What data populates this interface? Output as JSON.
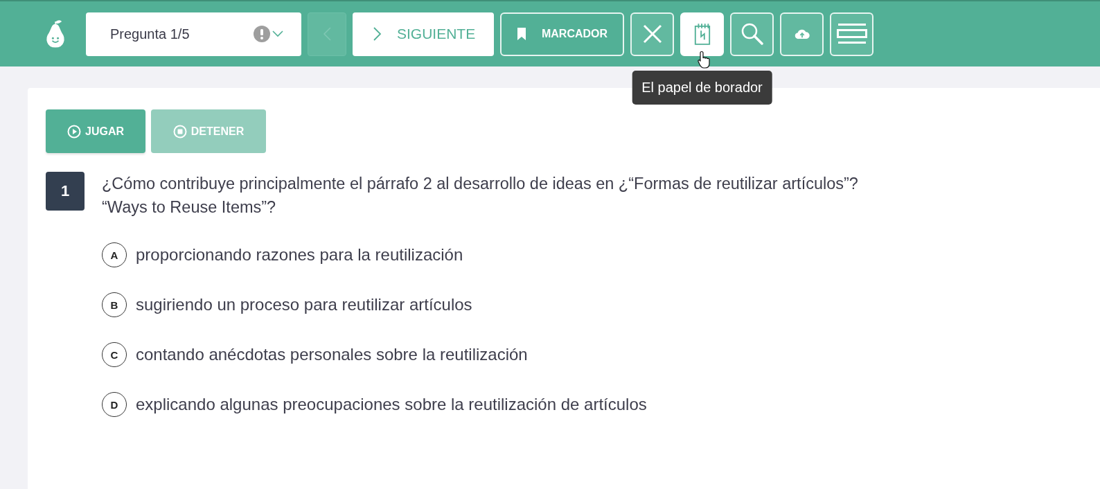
{
  "toolbar": {
    "question_selector": {
      "label": "Pregunta 1/5",
      "warning": true
    },
    "previous": {
      "disabled": true
    },
    "next": {
      "label": "SIGUIENTE",
      "disabled": false
    },
    "bookmark": {
      "label": "MARCADOR",
      "on": false
    },
    "tools": [
      {
        "kind": "close",
        "active": false
      },
      {
        "kind": "scratch",
        "active": true
      },
      {
        "kind": "search",
        "active": false
      },
      {
        "kind": "upload",
        "active": false
      },
      {
        "kind": "menu",
        "active": false
      }
    ],
    "tooltip": "El papel de borador"
  },
  "audio": [
    {
      "kind": "play",
      "label": "JUGAR",
      "disabled": false
    },
    {
      "kind": "stop",
      "label": "DETENER",
      "disabled": true
    }
  ],
  "question": {
    "number": "1",
    "lines": [
      "¿Cómo contribuye principalmente el párrafo 2 al desarrollo de ideas en ¿“Formas de reutilizar artículos”?",
      "“Ways to Reuse Items”?"
    ],
    "options": [
      {
        "letter": "A",
        "text": "proporcionando razones para la reutilización",
        "selected": false
      },
      {
        "letter": "B",
        "text": "sugiriendo un proceso para reutilizar artículos",
        "selected": false
      },
      {
        "letter": "C",
        "text": "contando anécdotas personales sobre la reutilización",
        "selected": false
      },
      {
        "letter": "D",
        "text": "explicando algunas preocupaciones sobre la reutilización de artículos",
        "selected": false
      }
    ]
  }
}
